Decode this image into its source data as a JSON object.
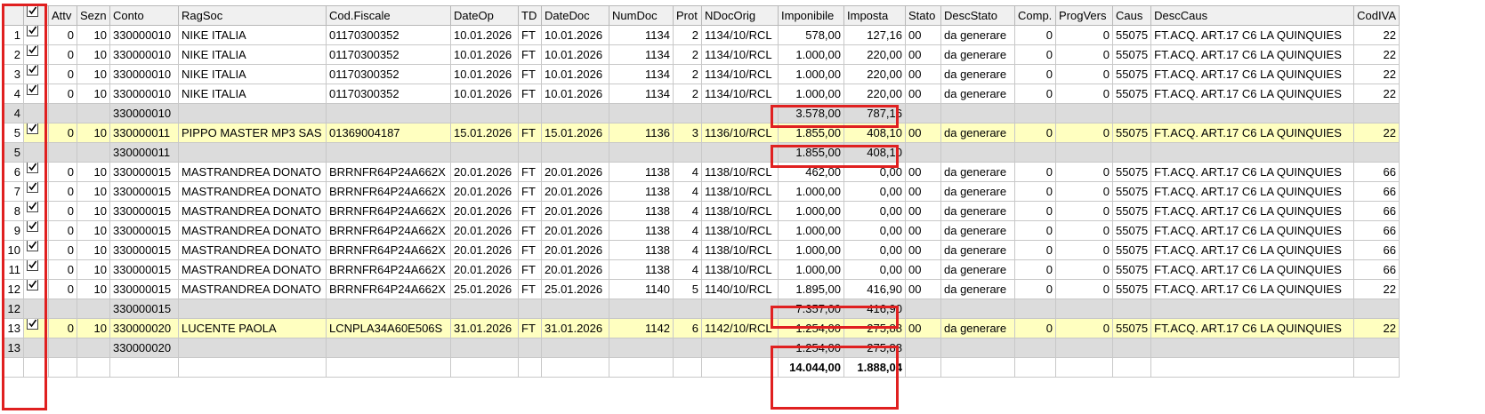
{
  "columns": [
    "",
    "Attv",
    "Sezn",
    "Conto",
    "RagSoc",
    "Cod.Fiscale",
    "DateOp",
    "TD",
    "DateDoc",
    "NumDoc",
    "Prot",
    "NDocOrig",
    "Imponibile",
    "Imposta",
    "Stato",
    "DescStato",
    "Comp.",
    "ProgVers",
    "Caus",
    "DescCaus",
    "CodIVA"
  ],
  "rows": [
    {
      "type": "data",
      "rn": "1",
      "checked": true,
      "cells": [
        "0",
        "10",
        "330000010",
        "NIKE ITALIA",
        "01170300352",
        "10.01.2026",
        "FT",
        "10.01.2026",
        "1134",
        "2",
        "1134/10/RCL",
        "578,00",
        "127,16",
        "00",
        "da generare",
        "0",
        "0",
        "55075",
        "FT.ACQ. ART.17 C6 LA QUINQUIES",
        "22"
      ]
    },
    {
      "type": "data",
      "rn": "2",
      "checked": true,
      "cells": [
        "0",
        "10",
        "330000010",
        "NIKE ITALIA",
        "01170300352",
        "10.01.2026",
        "FT",
        "10.01.2026",
        "1134",
        "2",
        "1134/10/RCL",
        "1.000,00",
        "220,00",
        "00",
        "da generare",
        "0",
        "0",
        "55075",
        "FT.ACQ. ART.17 C6 LA QUINQUIES",
        "22"
      ]
    },
    {
      "type": "data",
      "rn": "3",
      "checked": true,
      "cells": [
        "0",
        "10",
        "330000010",
        "NIKE ITALIA",
        "01170300352",
        "10.01.2026",
        "FT",
        "10.01.2026",
        "1134",
        "2",
        "1134/10/RCL",
        "1.000,00",
        "220,00",
        "00",
        "da generare",
        "0",
        "0",
        "55075",
        "FT.ACQ. ART.17 C6 LA QUINQUIES",
        "22"
      ]
    },
    {
      "type": "data",
      "rn": "4",
      "checked": true,
      "cells": [
        "0",
        "10",
        "330000010",
        "NIKE ITALIA",
        "01170300352",
        "10.01.2026",
        "FT",
        "10.01.2026",
        "1134",
        "2",
        "1134/10/RCL",
        "1.000,00",
        "220,00",
        "00",
        "da generare",
        "0",
        "0",
        "55075",
        "FT.ACQ. ART.17 C6 LA QUINQUIES",
        "22"
      ]
    },
    {
      "type": "sub",
      "rn": "4",
      "checked": false,
      "cells": [
        "",
        "",
        "330000010",
        "",
        "",
        "",
        "",
        "",
        "",
        "",
        "",
        "3.578,00",
        "787,16",
        "",
        "",
        "",
        "",
        "",
        "",
        ""
      ]
    },
    {
      "type": "hl",
      "rn": "5",
      "checked": true,
      "cells": [
        "0",
        "10",
        "330000011",
        "PIPPO MASTER MP3 SAS",
        "01369004187",
        "15.01.2026",
        "FT",
        "15.01.2026",
        "1136",
        "3",
        "1136/10/RCL",
        "1.855,00",
        "408,10",
        "00",
        "da generare",
        "0",
        "0",
        "55075",
        "FT.ACQ. ART.17 C6 LA QUINQUIES",
        "22"
      ]
    },
    {
      "type": "sub",
      "rn": "5",
      "checked": false,
      "cells": [
        "",
        "",
        "330000011",
        "",
        "",
        "",
        "",
        "",
        "",
        "",
        "",
        "1.855,00",
        "408,10",
        "",
        "",
        "",
        "",
        "",
        "",
        ""
      ]
    },
    {
      "type": "data",
      "rn": "6",
      "checked": true,
      "cells": [
        "0",
        "10",
        "330000015",
        "MASTRANDREA DONATO",
        "BRRNFR64P24A662X",
        "20.01.2026",
        "FT",
        "20.01.2026",
        "1138",
        "4",
        "1138/10/RCL",
        "462,00",
        "0,00",
        "00",
        "da generare",
        "0",
        "0",
        "55075",
        "FT.ACQ. ART.17 C6 LA QUINQUIES",
        "66"
      ]
    },
    {
      "type": "data",
      "rn": "7",
      "checked": true,
      "cells": [
        "0",
        "10",
        "330000015",
        "MASTRANDREA DONATO",
        "BRRNFR64P24A662X",
        "20.01.2026",
        "FT",
        "20.01.2026",
        "1138",
        "4",
        "1138/10/RCL",
        "1.000,00",
        "0,00",
        "00",
        "da generare",
        "0",
        "0",
        "55075",
        "FT.ACQ. ART.17 C6 LA QUINQUIES",
        "66"
      ]
    },
    {
      "type": "data",
      "rn": "8",
      "checked": true,
      "cells": [
        "0",
        "10",
        "330000015",
        "MASTRANDREA DONATO",
        "BRRNFR64P24A662X",
        "20.01.2026",
        "FT",
        "20.01.2026",
        "1138",
        "4",
        "1138/10/RCL",
        "1.000,00",
        "0,00",
        "00",
        "da generare",
        "0",
        "0",
        "55075",
        "FT.ACQ. ART.17 C6 LA QUINQUIES",
        "66"
      ]
    },
    {
      "type": "data",
      "rn": "9",
      "checked": true,
      "cells": [
        "0",
        "10",
        "330000015",
        "MASTRANDREA DONATO",
        "BRRNFR64P24A662X",
        "20.01.2026",
        "FT",
        "20.01.2026",
        "1138",
        "4",
        "1138/10/RCL",
        "1.000,00",
        "0,00",
        "00",
        "da generare",
        "0",
        "0",
        "55075",
        "FT.ACQ. ART.17 C6 LA QUINQUIES",
        "66"
      ]
    },
    {
      "type": "data",
      "rn": "10",
      "checked": true,
      "cells": [
        "0",
        "10",
        "330000015",
        "MASTRANDREA DONATO",
        "BRRNFR64P24A662X",
        "20.01.2026",
        "FT",
        "20.01.2026",
        "1138",
        "4",
        "1138/10/RCL",
        "1.000,00",
        "0,00",
        "00",
        "da generare",
        "0",
        "0",
        "55075",
        "FT.ACQ. ART.17 C6 LA QUINQUIES",
        "66"
      ]
    },
    {
      "type": "data",
      "rn": "11",
      "checked": true,
      "cells": [
        "0",
        "10",
        "330000015",
        "MASTRANDREA DONATO",
        "BRRNFR64P24A662X",
        "20.01.2026",
        "FT",
        "20.01.2026",
        "1138",
        "4",
        "1138/10/RCL",
        "1.000,00",
        "0,00",
        "00",
        "da generare",
        "0",
        "0",
        "55075",
        "FT.ACQ. ART.17 C6 LA QUINQUIES",
        "66"
      ]
    },
    {
      "type": "data",
      "rn": "12",
      "checked": true,
      "cells": [
        "0",
        "10",
        "330000015",
        "MASTRANDREA DONATO",
        "BRRNFR64P24A662X",
        "25.01.2026",
        "FT",
        "25.01.2026",
        "1140",
        "5",
        "1140/10/RCL",
        "1.895,00",
        "416,90",
        "00",
        "da generare",
        "0",
        "0",
        "55075",
        "FT.ACQ. ART.17 C6 LA QUINQUIES",
        "22"
      ]
    },
    {
      "type": "sub",
      "rn": "12",
      "checked": false,
      "cells": [
        "",
        "",
        "330000015",
        "",
        "",
        "",
        "",
        "",
        "",
        "",
        "",
        "7.357,00",
        "416,90",
        "",
        "",
        "",
        "",
        "",
        "",
        ""
      ]
    },
    {
      "type": "hl",
      "rn": "13",
      "checked": true,
      "cells": [
        "0",
        "10",
        "330000020",
        "LUCENTE PAOLA",
        "LCNPLA34A60E506S",
        "31.01.2026",
        "FT",
        "31.01.2026",
        "1142",
        "6",
        "1142/10/RCL",
        "1.254,00",
        "275,88",
        "00",
        "da generare",
        "0",
        "0",
        "55075",
        "FT.ACQ. ART.17 C6 LA QUINQUIES",
        "22"
      ]
    },
    {
      "type": "sub",
      "rn": "13",
      "checked": false,
      "cells": [
        "",
        "",
        "330000020",
        "",
        "",
        "",
        "",
        "",
        "",
        "",
        "",
        "1.254,00",
        "275,88",
        "",
        "",
        "",
        "",
        "",
        "",
        ""
      ]
    },
    {
      "type": "total",
      "rn": "",
      "checked": false,
      "cells": [
        "",
        "",
        "",
        "",
        "",
        "",
        "",
        "",
        "",
        "",
        "",
        "14.044,00",
        "1.888,04",
        "",
        "",
        "",
        "",
        "",
        "",
        ""
      ]
    }
  ],
  "colors": {
    "highlight": "#ffffc0",
    "subtotal": "#dcdcdc",
    "box": "#e02020"
  }
}
